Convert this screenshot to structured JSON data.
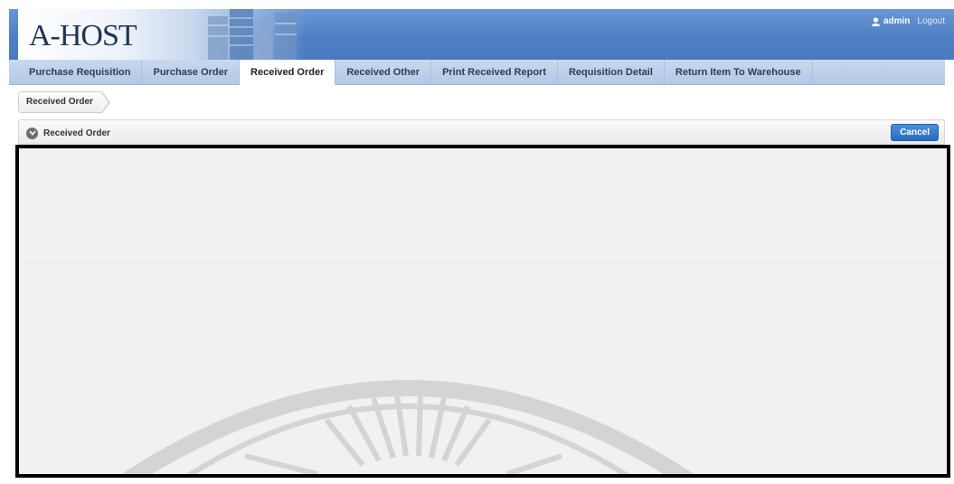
{
  "header": {
    "logo_text": "A-HOST",
    "user_name": "admin",
    "logout_label": "Logout"
  },
  "tabs": [
    {
      "label": "Purchase Requisition",
      "active": false
    },
    {
      "label": "Purchase Order",
      "active": false
    },
    {
      "label": "Received Order",
      "active": true
    },
    {
      "label": "Received Other",
      "active": false
    },
    {
      "label": "Print Received Report",
      "active": false
    },
    {
      "label": "Requisition Detail",
      "active": false
    },
    {
      "label": "Return Item To Warehouse",
      "active": false
    }
  ],
  "breadcrumb": {
    "current": "Received Order"
  },
  "region": {
    "title": "Received Order",
    "toggle_icon": "chevron-down-circle-icon",
    "cancel_label": "Cancel"
  },
  "colors": {
    "header_blue": "#4f7fc4",
    "tab_bar": "#b4c9e6",
    "button_blue": "#2a6bc2",
    "content_bg": "#f1f1f1"
  }
}
